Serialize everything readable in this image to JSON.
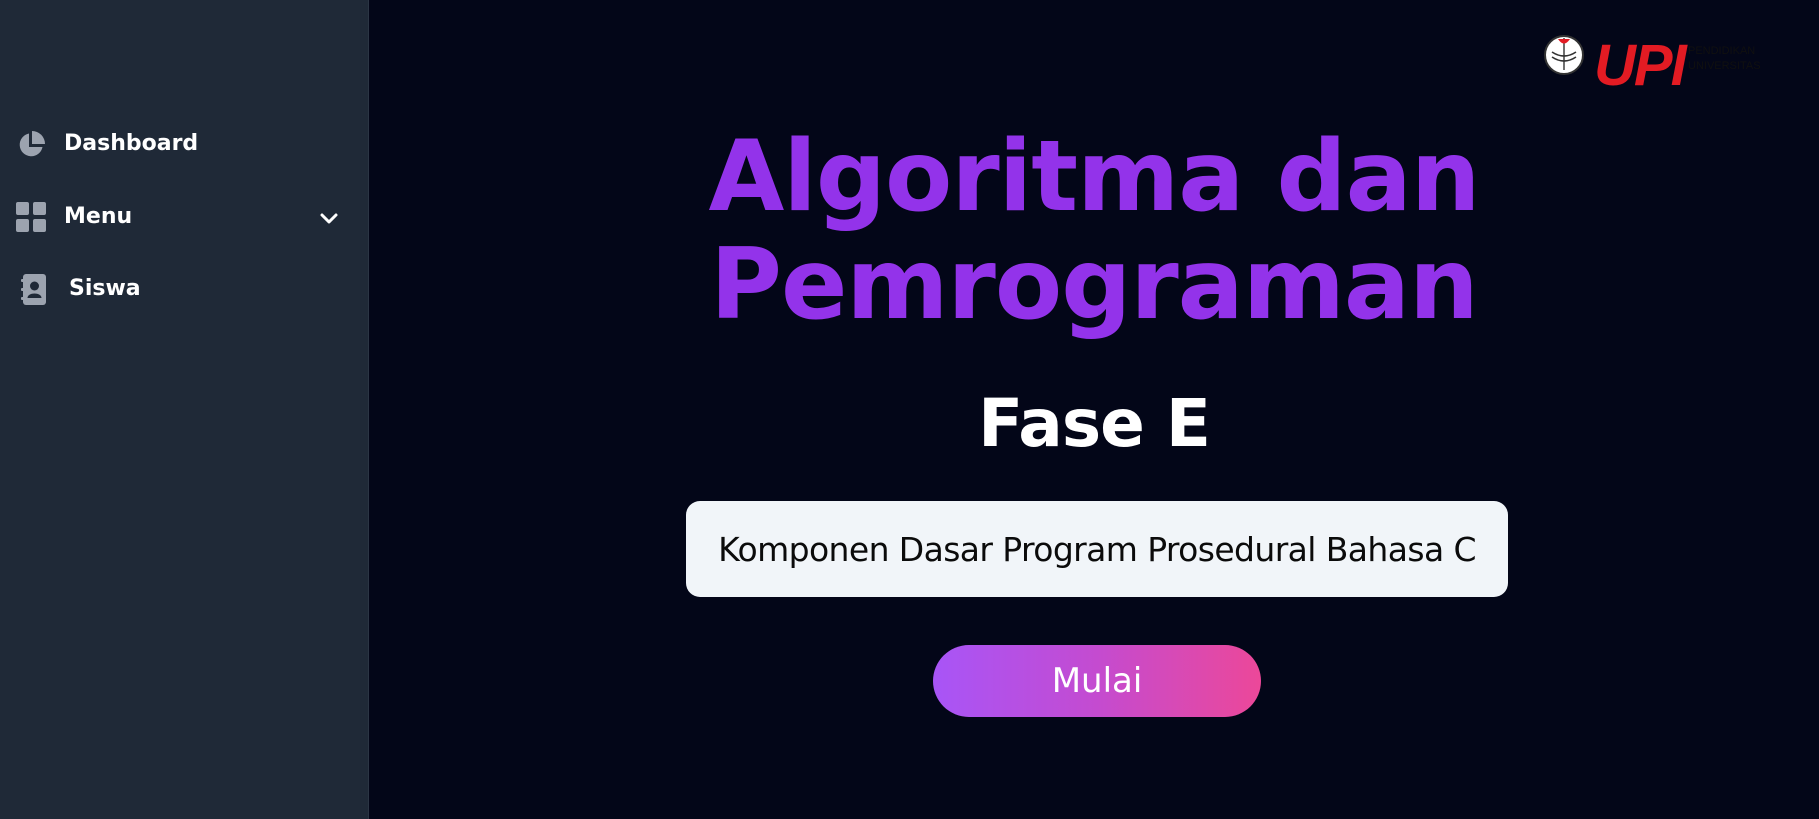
{
  "sidebar": {
    "items": [
      {
        "label": "Dashboard",
        "icon": "pie-chart-icon"
      },
      {
        "label": "Menu",
        "icon": "grid-icon",
        "expand_icon": "chevron-down-icon"
      },
      {
        "label": "Siswa",
        "icon": "contact-book-icon"
      }
    ]
  },
  "header": {
    "logo": {
      "name": "upi-logo",
      "text": "UPI",
      "subtext": "PENDIDIKAN UNIVERSITAS",
      "colors": {
        "brand": "#e31b23",
        "emblem": "#ffffff"
      }
    }
  },
  "main": {
    "title": "Algoritma dan Pemrograman",
    "subtitle": "Fase E",
    "topic": "Komponen Dasar Program Prosedural Bahasa C",
    "start_button": "Mulai"
  },
  "colors": {
    "background": "#030618",
    "sidebar": "#1f2937",
    "title": "#9333ea",
    "button_gradient_start": "#a855f7",
    "button_gradient_end": "#ec4899",
    "topic_box": "#f1f5f9",
    "icon": "#9ca3af"
  }
}
